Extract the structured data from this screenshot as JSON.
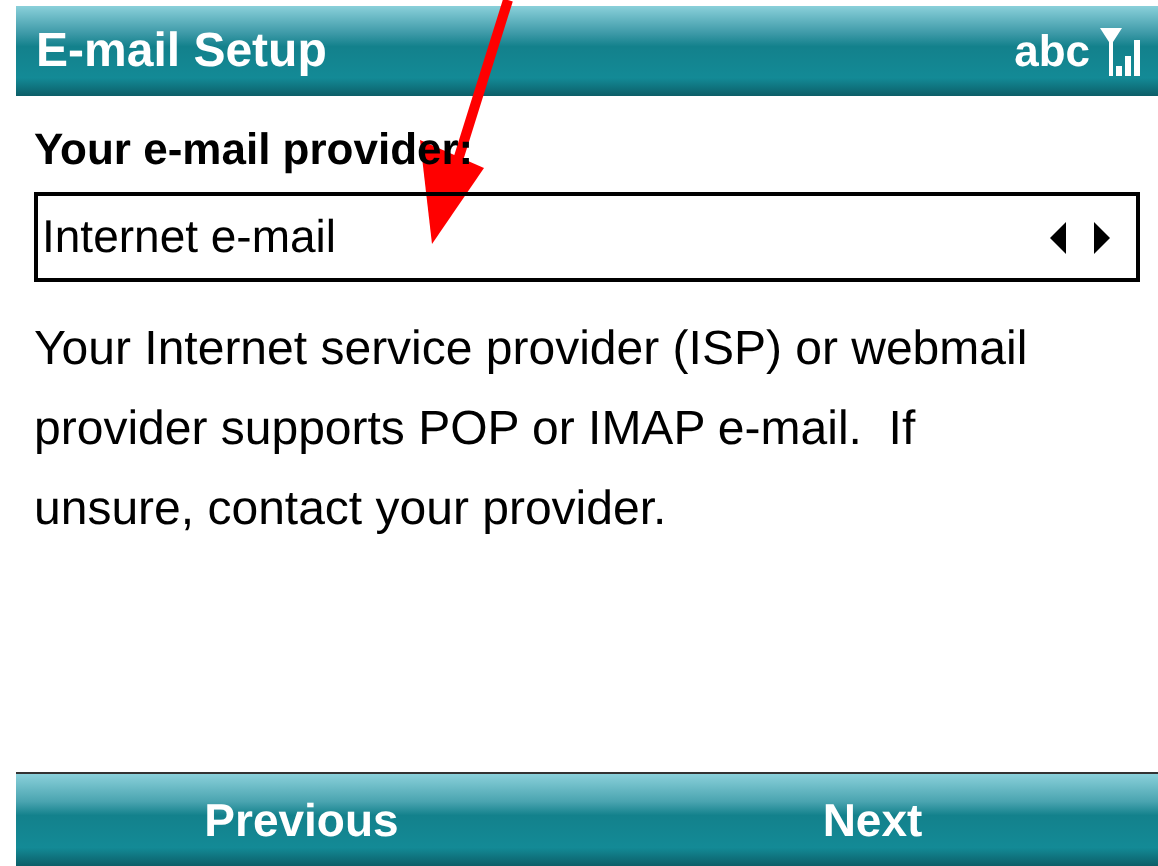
{
  "window": {
    "title": "E-mail Setup",
    "input_mode": "abc"
  },
  "provider": {
    "label": "Your e-mail provider:",
    "value": "Internet e-mail"
  },
  "description": "Your Internet service provider (ISP) or webmail provider supports POP or IMAP e-mail.  If unsure, contact your provider.",
  "softkeys": [
    "Previous",
    "Next"
  ]
}
